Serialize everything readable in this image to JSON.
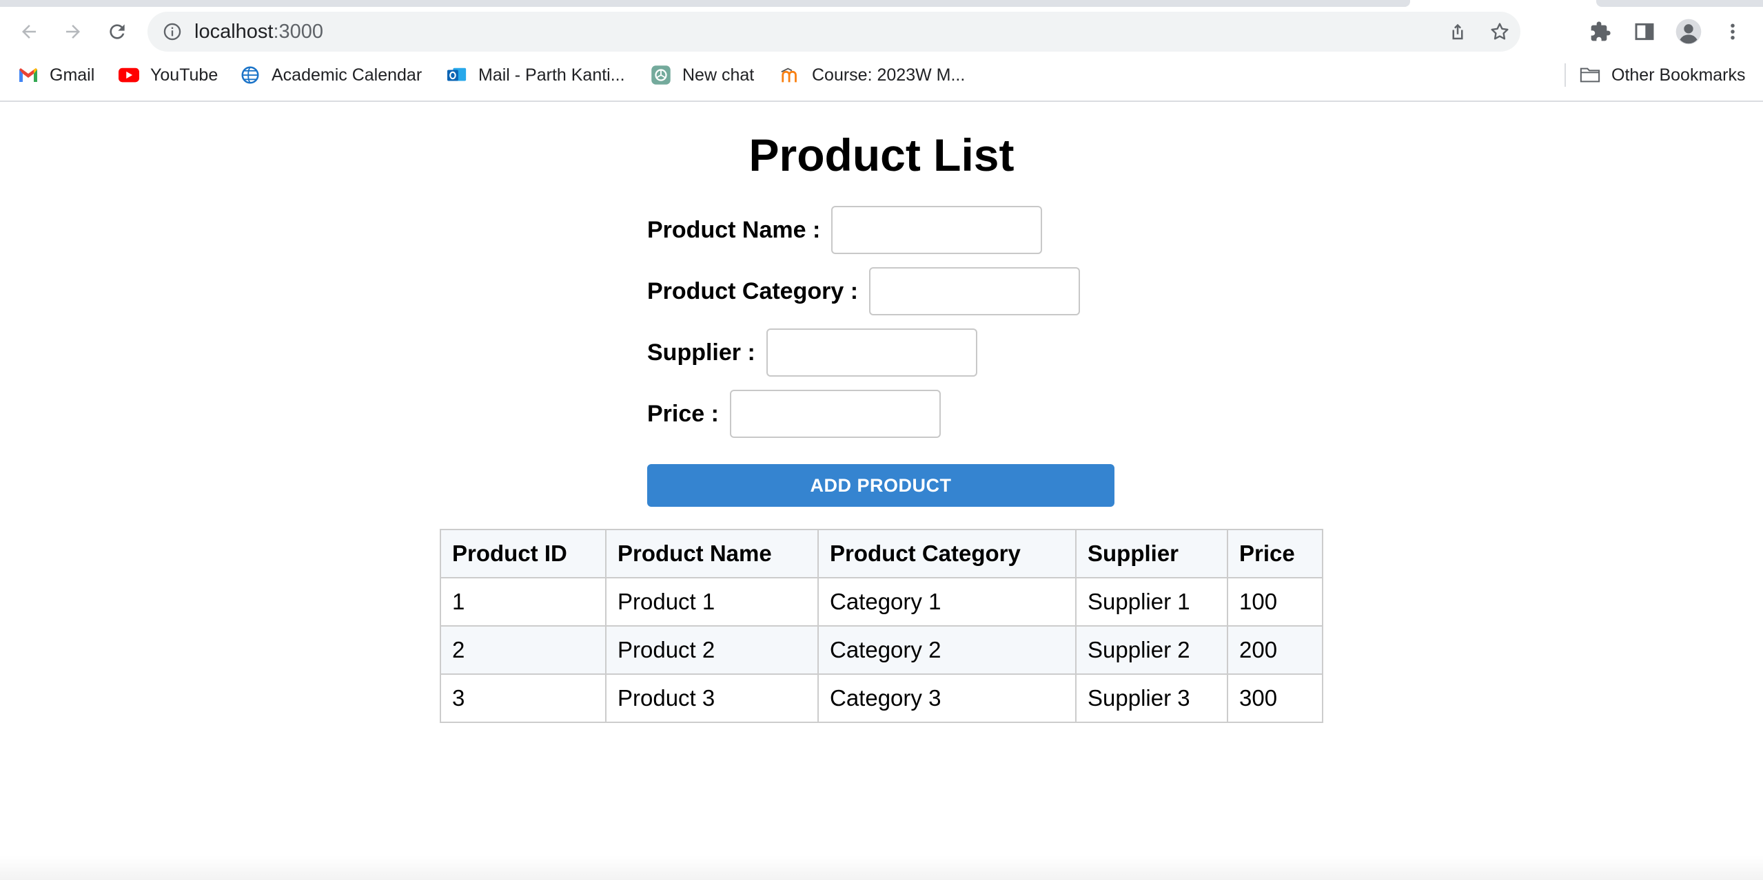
{
  "browser": {
    "url_host": "localhost",
    "url_port": ":3000",
    "bookmarks": [
      {
        "label": "Gmail",
        "icon": "gmail-icon"
      },
      {
        "label": "YouTube",
        "icon": "youtube-icon"
      },
      {
        "label": "Academic Calendar",
        "icon": "calendar-globe-icon"
      },
      {
        "label": "Mail - Parth Kanti...",
        "icon": "outlook-icon"
      },
      {
        "label": "New chat",
        "icon": "chatgpt-icon"
      },
      {
        "label": "Course: 2023W M...",
        "icon": "moodle-icon"
      }
    ],
    "other_bookmarks": "Other Bookmarks"
  },
  "page": {
    "title": "Product List",
    "form": {
      "product_name_label": "Product Name :",
      "product_name_value": "",
      "product_category_label": "Product Category :",
      "product_category_value": "",
      "supplier_label": "Supplier :",
      "supplier_value": "",
      "price_label": "Price :",
      "price_value": "",
      "add_button": "ADD PRODUCT"
    },
    "table": {
      "headers": [
        "Product ID",
        "Product Name",
        "Product Category",
        "Supplier",
        "Price"
      ],
      "rows": [
        [
          "1",
          "Product 1",
          "Category 1",
          "Supplier 1",
          "100"
        ],
        [
          "2",
          "Product 2",
          "Category 2",
          "Supplier 2",
          "200"
        ],
        [
          "3",
          "Product 3",
          "Category 3",
          "Supplier 3",
          "300"
        ]
      ]
    }
  },
  "colors": {
    "button": "#3584d0",
    "table_header_bg": "#f5f8fb",
    "table_border": "#cccccc"
  }
}
